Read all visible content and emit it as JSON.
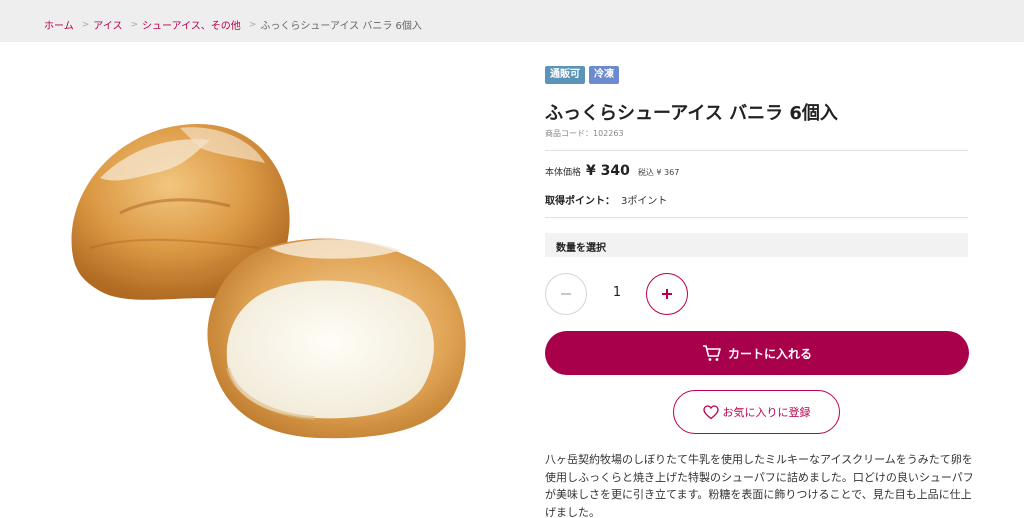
{
  "breadcrumb": {
    "items": [
      "ホーム",
      "アイス",
      "シューアイス、その他"
    ],
    "current": "ふっくらシューアイス バニラ 6個入",
    "separator": ">"
  },
  "product": {
    "image_alt": "ふっくらシューアイス バニラ",
    "badges": [
      "通販可",
      "冷凍"
    ],
    "title": "ふっくらシューアイス バニラ 6個入",
    "code": "商品コード：102263",
    "price_label": "本体価格",
    "price": "¥ 340",
    "price_tax": "税込 ¥ 367",
    "points_label": "取得ポイント：",
    "points_value": "3ポイント"
  },
  "quantity": {
    "heading": "数量を選択",
    "value": "1",
    "minus_icon": "minus-icon",
    "plus_icon": "plus-icon"
  },
  "actions": {
    "cart_label": "カートに入れる",
    "cart_icon": "cart-icon",
    "favorite_label": "お気に入りに登録",
    "favorite_icon": "heart-icon"
  },
  "description": "八ヶ岳契約牧場のしぼりたて牛乳を使用したミルキーなアイスクリームをうみたて卵を使用しふっくらと焼き上げた特製のシューパフに詰めました。口どけの良いシューパフが美味しさを更に引き立てます。粉糖を表面に飾りつけることで、見た目も上品に仕上げました。",
  "colors": {
    "accent": "#a8004a",
    "badge_mail": "#5b94b8",
    "badge_frozen": "#6c8ad0",
    "breadcrumb_bg": "#eeeeee"
  }
}
